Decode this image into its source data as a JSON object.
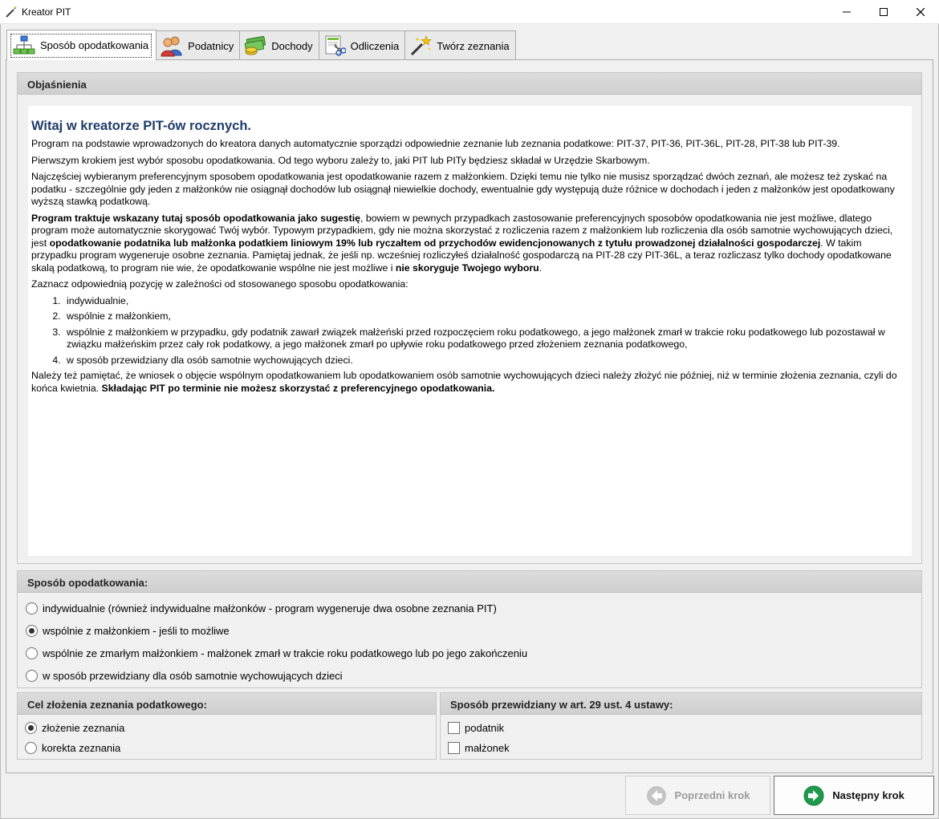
{
  "window": {
    "title": "Kreator PIT"
  },
  "tabs": [
    {
      "label": "Sposób opodatkowania",
      "icon": "network-icon",
      "active": true
    },
    {
      "label": "Podatnicy",
      "icon": "users-icon",
      "active": false
    },
    {
      "label": "Dochody",
      "icon": "money-icon",
      "active": false
    },
    {
      "label": "Odliczenia",
      "icon": "scissors-doc-icon",
      "active": false
    },
    {
      "label": "Twórz zeznania",
      "icon": "magic-wand-icon",
      "active": false
    }
  ],
  "explain": {
    "header": "Objaśnienia",
    "heading": "Witaj w kreatorze PIT-ów rocznych.",
    "p1": "Program na podstawie wprowadzonych do kreatora danych automatycznie sporządzi odpowiednie zeznanie lub zeznania podatkowe: PIT-37, PIT-36, PIT-36L, PIT-28, PIT-38 lub PIT-39.",
    "p2": "Pierwszym krokiem jest wybór sposobu opodatkowania. Od tego wyboru zależy to, jaki PIT lub PITy będziesz składał w Urzędzie Skarbowym.",
    "p3": "Najczęściej wybieranym preferencyjnym sposobem opodatkowania jest opodatkowanie razem z małżonkiem. Dzięki temu nie tylko nie musisz sporządzać dwóch zeznań, ale możesz też zyskać na podatku - szczególnie gdy jeden z małżonków nie osiągnął dochodów lub osiągnął niewielkie dochody, ewentualnie gdy występują duże różnice w dochodach i jeden z małżonków jest opodatkowany wyższą stawką podatkową.",
    "p4_b1": "Program traktuje wskazany tutaj sposób opodatkowania jako sugestię",
    "p4_t1": ", bowiem w pewnych przypadkach zastosowanie preferencyjnych sposobów opodatkowania nie jest możliwe, dlatego program może automatycznie skorygować Twój wybór. Typowym przypadkiem, gdy nie można skorzystać z rozliczenia razem z małżonkiem lub rozliczenia dla osób samotnie wychowujących dzieci, jest ",
    "p4_b2": "opodatkowanie podatnika lub małżonka podatkiem liniowym 19% lub ryczałtem od przychodów ewidencjonowanych z tytułu prowadzonej działalności gospodarczej",
    "p4_t2": ". W takim przypadku program wygeneruje osobne zeznania. Pamiętaj jednak, że jeśli np. wcześniej rozliczyłeś działalność gospodarczą na PIT-28 czy PIT-36L, a teraz rozliczasz tylko dochody opodatkowane skalą podatkową, to program nie wie, że opodatkowanie wspólne nie jest możliwe i ",
    "p4_b3": "nie skoryguje Twojego wyboru",
    "p4_t3": ".",
    "p5": "Zaznacz odpowiednią pozycję w zależności od stosowanego sposobu opodatkowania:",
    "list": [
      "indywidualnie,",
      "wspólnie z małżonkiem,",
      "wspólnie z małżonkiem w przypadku, gdy podatnik zawarł związek małżeński przed rozpoczęciem roku podatkowego, a jego małżonek zmarł w trakcie roku podatkowego lub pozostawał w związku małżeńskim przez cały rok podatkowy, a jego małżonek zmarł po upływie roku podatkowego przed złożeniem zeznania podatkowego,",
      "w sposób przewidziany dla osób samotnie wychowujących dzieci."
    ],
    "p6_t1": "Należy też pamiętać, że wniosek o objęcie wspólnym opodatkowaniem lub opodatkowaniem osób samotnie wychowujących dzieci należy złożyć nie później, niż w terminie złożenia zeznania, czyli do końca kwietnia. ",
    "p6_b1": "Składając PIT po terminie nie możesz skorzystać z preferencyjnego opodatkowania."
  },
  "sposob": {
    "header": "Sposób opodatkowania:",
    "options": [
      {
        "label": "indywidualnie (również indywidualne małżonków - program wygeneruje dwa osobne zeznania PIT)",
        "selected": false
      },
      {
        "label": "wspólnie z małżonkiem - jeśli to możliwe",
        "selected": true
      },
      {
        "label": "wspólnie ze zmarłym małżonkiem - małżonek zmarł w trakcie roku podatkowego lub po jego zakończeniu",
        "selected": false
      },
      {
        "label": "w sposób przewidziany dla osób samotnie wychowujących dzieci",
        "selected": false
      }
    ]
  },
  "cel": {
    "header": "Cel złożenia zeznania podatkowego:",
    "options": [
      {
        "label": "złożenie zeznania",
        "selected": true
      },
      {
        "label": "korekta zeznania",
        "selected": false
      }
    ]
  },
  "art": {
    "header": "Sposób przewidziany w art. 29 ust. 4 ustawy:",
    "options": [
      {
        "label": "podatnik",
        "checked": false
      },
      {
        "label": "małżonek",
        "checked": false
      }
    ]
  },
  "buttons": {
    "prev": "Poprzedni krok",
    "next": "Następny krok"
  },
  "colors": {
    "heading": "#1f3c6b",
    "next_arrow": "#1e9a4a",
    "prev_arrow_disabled": "#bdbdbd"
  }
}
